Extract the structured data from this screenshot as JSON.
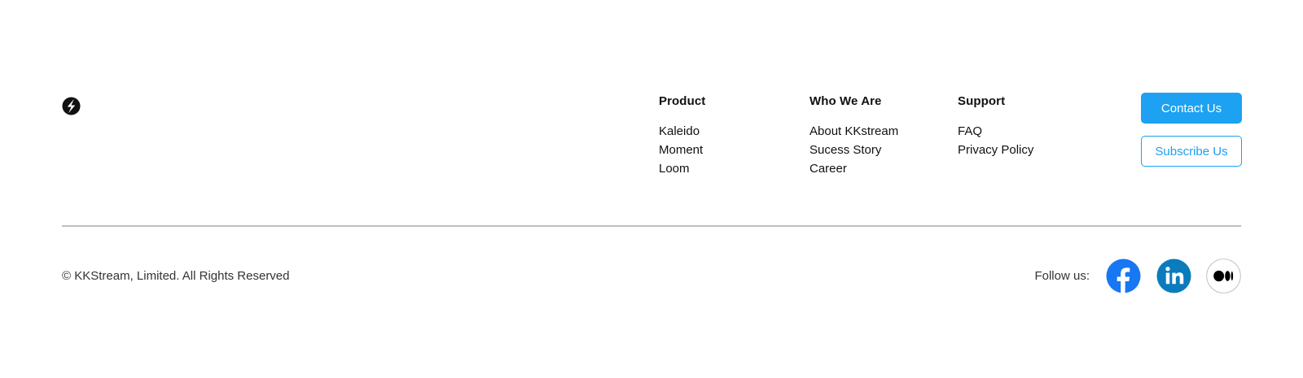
{
  "brand": {
    "logo_icon": "kkstream-logo-icon"
  },
  "nav": {
    "columns": [
      {
        "heading": "Product",
        "items": [
          "Kaleido",
          "Moment",
          "Loom"
        ]
      },
      {
        "heading": "Who We Are",
        "items": [
          "About KKstream",
          "Sucess Story",
          "Career"
        ]
      },
      {
        "heading": "Support",
        "items": [
          "FAQ",
          "Privacy Policy"
        ]
      }
    ]
  },
  "actions": {
    "contact_label": "Contact Us",
    "subscribe_label": "Subscribe Us"
  },
  "bottom": {
    "copyright": "© KKStream, Limited. All Rights Reserved",
    "follow_label": "Follow us:",
    "social": [
      {
        "icon": "facebook-icon",
        "color": "#1877f2"
      },
      {
        "icon": "linkedin-icon",
        "color": "#0a7bbd"
      },
      {
        "icon": "medium-icon",
        "color": "#000000"
      }
    ]
  },
  "colors": {
    "accent": "#1da1f2",
    "divider": "#bdbdbd",
    "text": "#111111"
  }
}
